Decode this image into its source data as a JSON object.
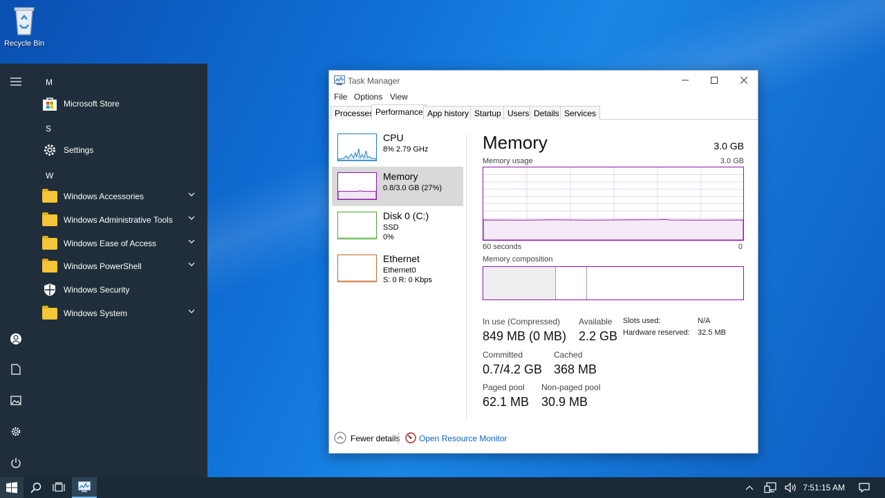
{
  "desktop": {
    "recycle_bin_label": "Recycle Bin"
  },
  "start_menu": {
    "letters": [
      "M",
      "S",
      "W"
    ],
    "apps": [
      {
        "label": "Microsoft Store",
        "icon": "store-icon",
        "expandable": false
      },
      {
        "label": "Settings",
        "icon": "gear-icon",
        "expandable": false
      },
      {
        "label": "Windows Accessories",
        "icon": "folder-icon",
        "expandable": true
      },
      {
        "label": "Windows Administrative Tools",
        "icon": "folder-icon",
        "expandable": true
      },
      {
        "label": "Windows Ease of Access",
        "icon": "folder-icon",
        "expandable": true
      },
      {
        "label": "Windows PowerShell",
        "icon": "folder-icon",
        "expandable": true
      },
      {
        "label": "Windows Security",
        "icon": "shield-icon",
        "expandable": false
      },
      {
        "label": "Windows System",
        "icon": "folder-icon",
        "expandable": true
      }
    ],
    "rail": [
      "hamburger-icon",
      "user-icon",
      "document-icon",
      "pictures-icon",
      "settings-icon",
      "power-icon"
    ]
  },
  "task_manager": {
    "title": "Task Manager",
    "menus": [
      "File",
      "Options",
      "View"
    ],
    "tabs": [
      "Processes",
      "Performance",
      "App history",
      "Startup",
      "Users",
      "Details",
      "Services"
    ],
    "active_tab": "Performance",
    "sidebar": [
      {
        "name": "CPU",
        "line2": "8%  2.79 GHz",
        "line3": "",
        "color": "#1a7fc1"
      },
      {
        "name": "Memory",
        "line2": "0.8/3.0 GB (27%)",
        "line3": "",
        "color": "#8b12ae"
      },
      {
        "name": "Disk 0 (C:)",
        "line2": "SSD",
        "line3": "0%",
        "color": "#4aa82e"
      },
      {
        "name": "Ethernet",
        "line2": "Ethernet0",
        "line3": "S: 0  R: 0 Kbps",
        "color": "#c9672a"
      }
    ],
    "memory": {
      "title": "Memory",
      "total": "3.0 GB",
      "usage_label": "Memory usage",
      "usage_max": "3.0 GB",
      "time_left": "60 seconds",
      "time_right": "0",
      "composition_label": "Memory composition",
      "usage_fraction": 0.27,
      "in_use_label": "In use (Compressed)",
      "in_use_value": "849 MB (0 MB)",
      "available_label": "Available",
      "available_value": "2.2 GB",
      "committed_label": "Committed",
      "committed_value": "0.7/4.2 GB",
      "cached_label": "Cached",
      "cached_value": "368 MB",
      "paged_label": "Paged pool",
      "paged_value": "62.1 MB",
      "nonpaged_label": "Non-paged pool",
      "nonpaged_value": "30.9 MB",
      "slots_label": "Slots used:",
      "slots_value": "N/A",
      "hw_label": "Hardware reserved:",
      "hw_value": "32.5 MB"
    },
    "footer": {
      "fewer_details": "Fewer details",
      "open_resmon": "Open Resource Monitor"
    }
  },
  "taskbar": {
    "clock": "7:51:15 AM"
  }
}
